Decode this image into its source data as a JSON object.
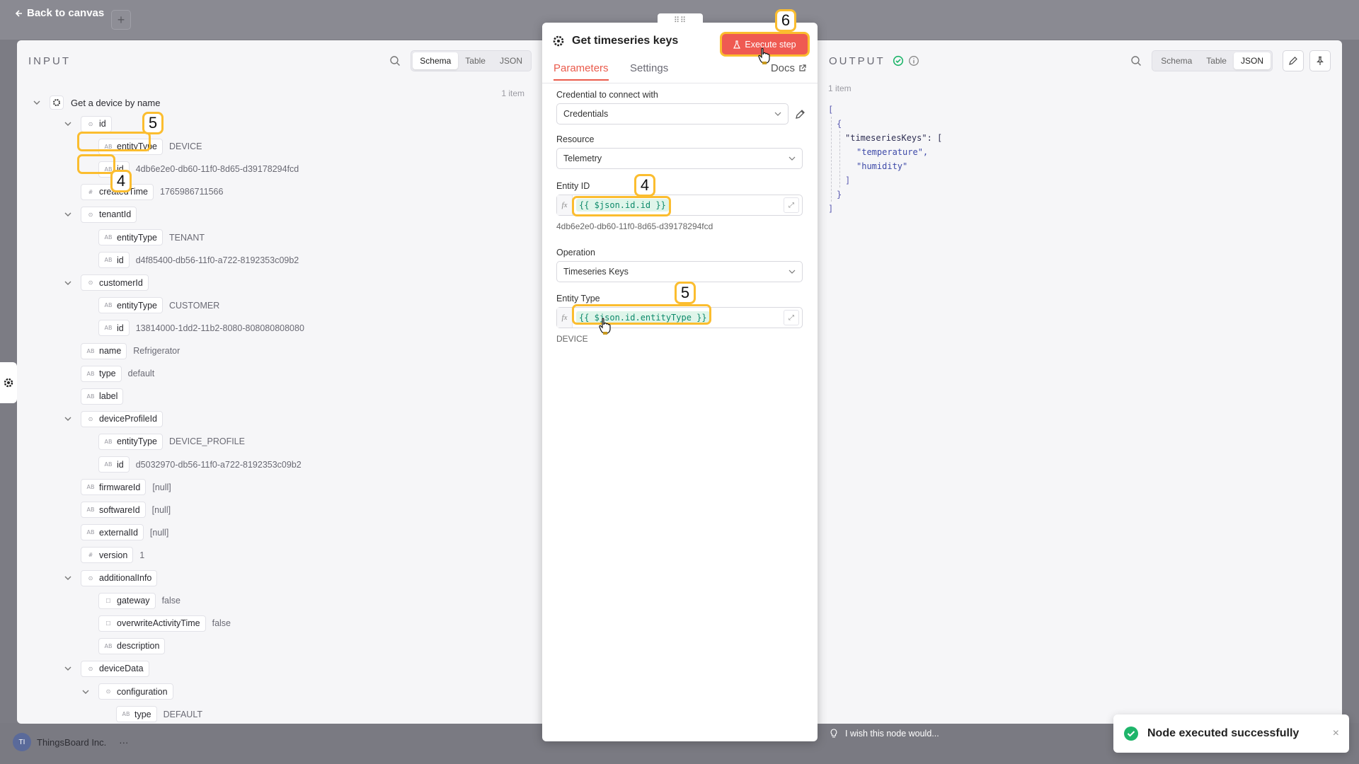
{
  "canvas": {
    "back_label": "Back to canvas",
    "plus_label": "+",
    "workspace_initials": "TI",
    "workspace_name": "ThingsBoard Inc.",
    "workspace_more": "···"
  },
  "input": {
    "title": "INPUT",
    "tabs": [
      "Schema",
      "Table",
      "JSON"
    ],
    "active_tab": "Schema",
    "root_label": "Get a device by name",
    "item_count": "1 item",
    "rows": [
      {
        "label": "id",
        "type": "obj"
      },
      {
        "label": "entityType",
        "type": "str",
        "value": "DEVICE"
      },
      {
        "label": "id",
        "type": "str",
        "value": "4db6e2e0-db60-11f0-8d65-d39178294fcd"
      },
      {
        "label": "createdTime",
        "type": "num",
        "value": "1765986711566"
      },
      {
        "label": "tenantId",
        "type": "obj"
      },
      {
        "label": "entityType",
        "type": "str",
        "value": "TENANT"
      },
      {
        "label": "id",
        "type": "str",
        "value": "d4f85400-db56-11f0-a722-8192353c09b2"
      },
      {
        "label": "customerId",
        "type": "obj"
      },
      {
        "label": "entityType",
        "type": "str",
        "value": "CUSTOMER"
      },
      {
        "label": "id",
        "type": "str",
        "value": "13814000-1dd2-11b2-8080-808080808080"
      },
      {
        "label": "name",
        "type": "str",
        "value": "Refrigerator"
      },
      {
        "label": "type",
        "type": "str",
        "value": "default"
      },
      {
        "label": "label",
        "type": "str",
        "value": ""
      },
      {
        "label": "deviceProfileId",
        "type": "obj"
      },
      {
        "label": "entityType",
        "type": "str",
        "value": "DEVICE_PROFILE"
      },
      {
        "label": "id",
        "type": "str",
        "value": "d5032970-db56-11f0-a722-8192353c09b2"
      },
      {
        "label": "firmwareId",
        "type": "str",
        "value": "[null]"
      },
      {
        "label": "softwareId",
        "type": "str",
        "value": "[null]"
      },
      {
        "label": "externalId",
        "type": "str",
        "value": "[null]"
      },
      {
        "label": "version",
        "type": "num",
        "value": "1"
      },
      {
        "label": "additionalInfo",
        "type": "obj"
      },
      {
        "label": "gateway",
        "type": "bool",
        "value": "false"
      },
      {
        "label": "overwriteActivityTime",
        "type": "bool",
        "value": "false"
      },
      {
        "label": "description",
        "type": "str",
        "value": ""
      },
      {
        "label": "deviceData",
        "type": "obj"
      },
      {
        "label": "configuration",
        "type": "obj"
      },
      {
        "label": "type",
        "type": "str",
        "value": "DEFAULT"
      }
    ]
  },
  "node": {
    "title": "Get timeseries keys",
    "execute_label": "Execute step",
    "tabs": [
      "Parameters",
      "Settings"
    ],
    "docs_label": "Docs",
    "credential_label": "Credential to connect with",
    "credential_value": "Credentials",
    "resource_label": "Resource",
    "resource_value": "Telemetry",
    "entity_id_label": "Entity ID",
    "entity_id_expr": "{{ $json.id.id }}",
    "entity_id_hint": "4db6e2e0-db60-11f0-8d65-d39178294fcd",
    "operation_label": "Operation",
    "operation_value": "Timeseries Keys",
    "entity_type_label": "Entity Type",
    "entity_type_expr": "{{ $json.id.entityType }}",
    "entity_type_hint": "DEVICE",
    "fx_label": "fx"
  },
  "output": {
    "title": "OUTPUT",
    "tabs": [
      "Schema",
      "Table",
      "JSON"
    ],
    "active_tab": "JSON",
    "item_count": "1 item",
    "json_lines": [
      "[",
      "{",
      "\"timeseriesKeys\": [",
      "\"temperature\",",
      "\"humidity\"",
      "]",
      "}",
      "]"
    ],
    "wish_text": "I wish this node would..."
  },
  "toast": {
    "message": "Node executed successfully",
    "close": "×"
  },
  "annotations": {
    "badge_5a": "5",
    "badge_4a": "4",
    "badge_6": "6",
    "badge_4b": "4",
    "badge_5b": "5"
  },
  "colors": {
    "accent": "#ea5b4c",
    "execute_button": "#ef5a52",
    "highlight": "#fbbd2f",
    "success": "#1eb56a",
    "expression": "#0d8a6a"
  }
}
